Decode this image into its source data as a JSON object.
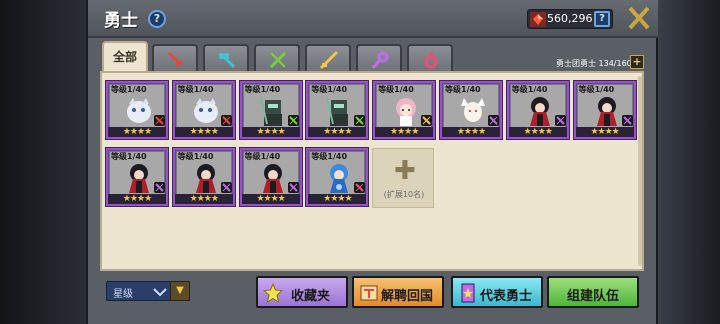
{
  "header": {
    "title": "勇士",
    "help_label": "?",
    "currency_value": "560,296",
    "currency_help_label": "?"
  },
  "tabs": [
    {
      "label": "全部",
      "icon": "all",
      "active": true
    },
    {
      "label": "",
      "icon": "sword-icon",
      "color": "#e8463c"
    },
    {
      "label": "",
      "icon": "hammer-icon",
      "color": "#3cc4d0"
    },
    {
      "label": "",
      "icon": "crossed-arrows-icon",
      "color": "#7ad03c"
    },
    {
      "label": "",
      "icon": "rifle-icon",
      "color": "#f2c744"
    },
    {
      "label": "",
      "icon": "staff-icon",
      "color": "#c06ce8"
    },
    {
      "label": "",
      "icon": "amulet-icon",
      "color": "#e8507a"
    }
  ],
  "roster": {
    "label": "勇士团勇士 134/160",
    "add_label": "+"
  },
  "cards": [
    {
      "level": "等级1/40",
      "stars": "★★★★",
      "class_color": "#e8463c",
      "hero": "white-spirit"
    },
    {
      "level": "等级1/40",
      "stars": "★★★★",
      "class_color": "#e8463c",
      "hero": "white-spirit"
    },
    {
      "level": "等级1/40",
      "stars": "★★★★",
      "class_color": "#7ad03c",
      "hero": "dark-armor"
    },
    {
      "level": "等级1/40",
      "stars": "★★★★",
      "class_color": "#7ad03c",
      "hero": "dark-armor"
    },
    {
      "level": "等级1/40",
      "stars": "★★★★",
      "class_color": "#f2c744",
      "hero": "pink-hair"
    },
    {
      "level": "等级1/40",
      "stars": "★★★★",
      "class_color": "#c06ce8",
      "hero": "white-fox"
    },
    {
      "level": "等级1/40",
      "stars": "★★★★",
      "class_color": "#c06ce8",
      "hero": "dark-witch"
    },
    {
      "level": "等级1/40",
      "stars": "★★★★",
      "class_color": "#c06ce8",
      "hero": "dark-witch"
    },
    {
      "level": "等级1/40",
      "stars": "★★★★",
      "class_color": "#c06ce8",
      "hero": "dark-witch"
    },
    {
      "level": "等级1/40",
      "stars": "★★★★",
      "class_color": "#c06ce8",
      "hero": "dark-witch"
    },
    {
      "level": "等级1/40",
      "stars": "★★★★",
      "class_color": "#c06ce8",
      "hero": "dark-witch"
    },
    {
      "level": "等级1/40",
      "stars": "★★★★",
      "class_color": "#e8507a",
      "hero": "blue-mage"
    }
  ],
  "expand_slot": {
    "label": "(扩展10名)"
  },
  "footer": {
    "sort_value": "星级",
    "sort_toggle": "▼",
    "buttons": {
      "collection": "收藏夹",
      "dismiss": "解聘回国",
      "representative": "代表勇士",
      "build_team": "组建队伍"
    }
  },
  "colors": {
    "panel_bg": "#ede5cf",
    "card_border": "#9a4fd0",
    "star": "#f2c744"
  }
}
